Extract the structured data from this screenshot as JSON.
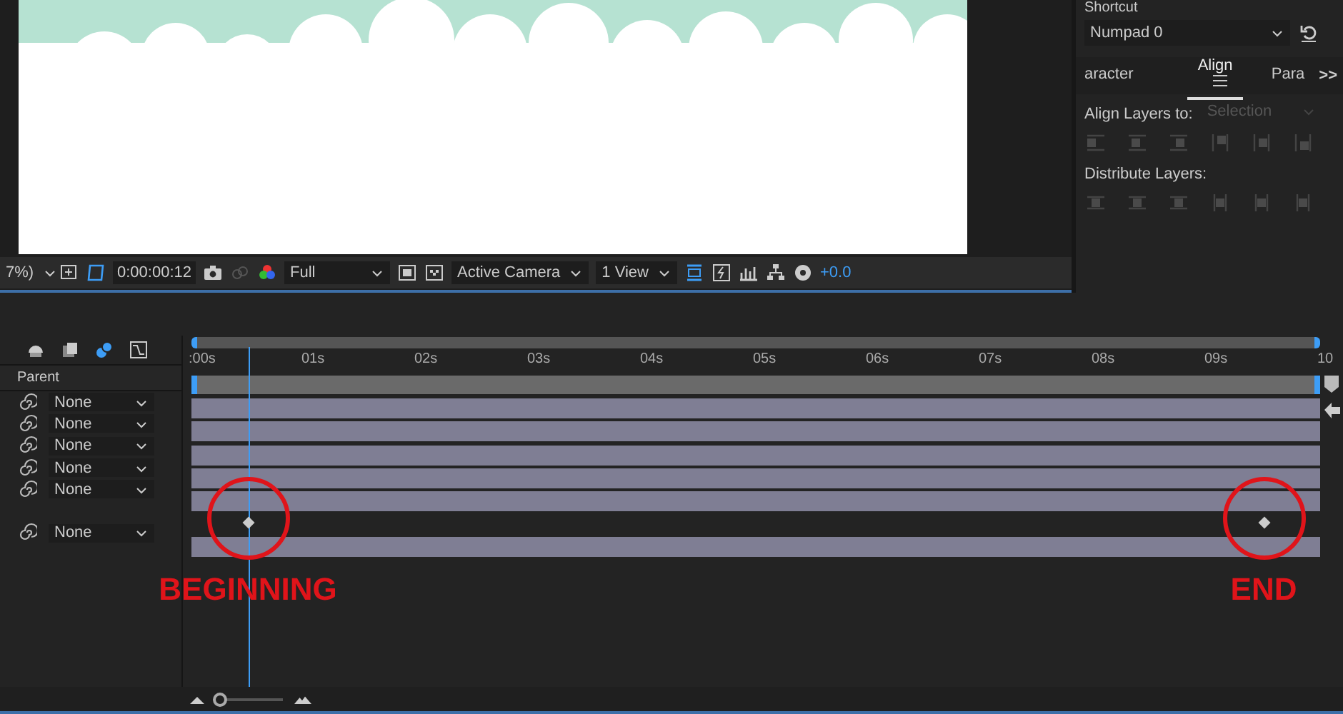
{
  "viewer_toolbar": {
    "zoom": "7%)",
    "timecode": "0:00:00:12",
    "resolution": "Full",
    "camera": "Active Camera",
    "views": "1 View",
    "exposure": "+0.0"
  },
  "side_panel": {
    "section_title": "Shortcut",
    "shortcut": "Numpad 0",
    "tabs": [
      {
        "label": "aracter",
        "selected": false
      },
      {
        "label": "Align",
        "selected": true
      },
      {
        "label": "Para",
        "selected": false
      }
    ],
    "more": ">>",
    "align_label": "Align Layers to:",
    "align_target": "Selection",
    "distribute_label": "Distribute Layers:"
  },
  "timeline": {
    "ruler": [
      ":00s",
      "01s",
      "02s",
      "03s",
      "04s",
      "05s",
      "06s",
      "07s",
      "08s",
      "09s",
      "10"
    ],
    "playhead": {
      "level": 0.05
    },
    "column_header": "Parent",
    "zoom_slider": {
      "level": 0.05
    },
    "rows": [
      {
        "kind": "layer",
        "parent": "None"
      },
      {
        "kind": "layer",
        "parent": "None"
      },
      {
        "kind": "layer",
        "parent": "None"
      },
      {
        "kind": "layer",
        "parent": "None"
      },
      {
        "kind": "layer",
        "parent": "None"
      },
      {
        "kind": "keyframes"
      },
      {
        "kind": "layer",
        "parent": "None"
      }
    ]
  },
  "annotations": [
    {
      "kind": "start",
      "text": "BEGINNING"
    },
    {
      "kind": "end",
      "text": "END"
    }
  ]
}
